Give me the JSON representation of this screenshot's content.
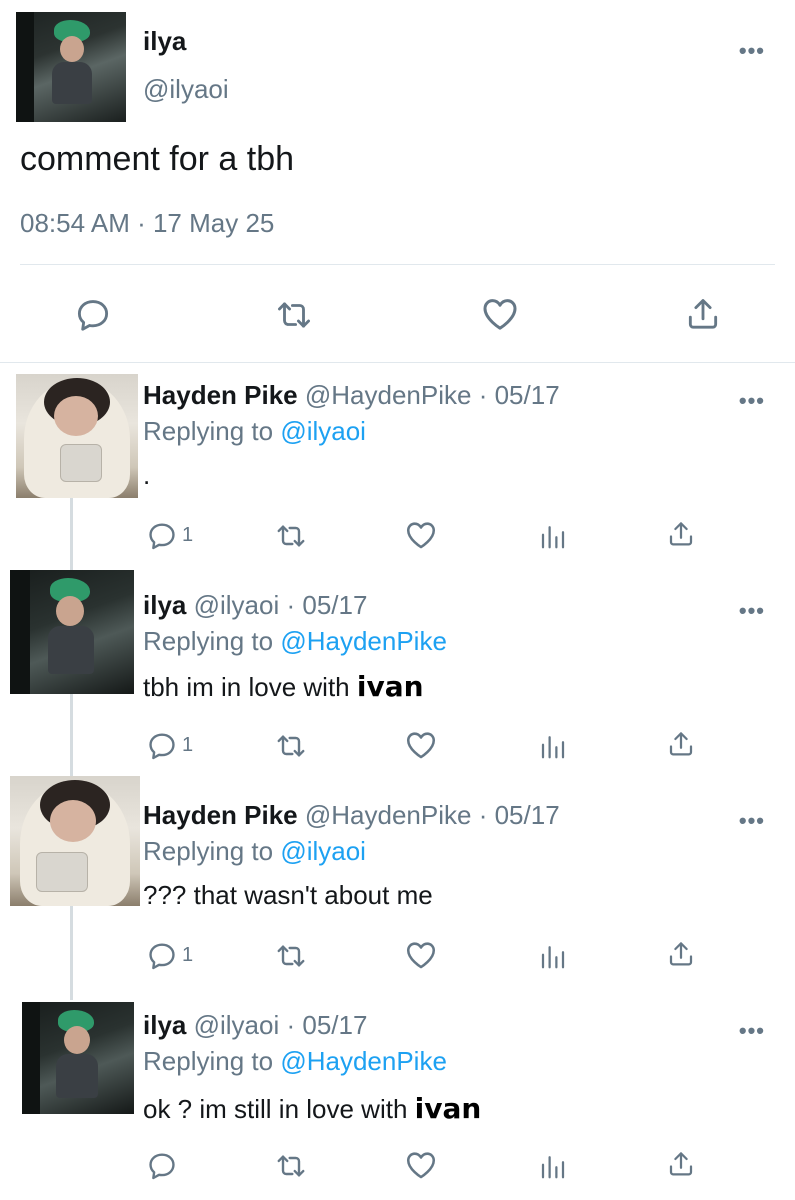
{
  "main_tweet": {
    "display_name": "ilya",
    "handle": "@ilyaoi",
    "text": "comment for a tbh",
    "timestamp": "08:54 AM · 17 May 25",
    "more_label": "•••"
  },
  "replies": [
    {
      "display_name": "Hayden Pike",
      "handle": "@HaydenPike",
      "date": "· 05/17",
      "replying_prefix": "Replying to",
      "replying_to": "@ilyaoi",
      "text": ".",
      "reply_count": "1",
      "more_label": "•••"
    },
    {
      "display_name": "ilya",
      "handle": "@ilyaoi",
      "date": "· 05/17",
      "replying_prefix": "Replying to",
      "replying_to": "@HaydenPike",
      "text": "tbh im in love with",
      "text_name": "ivan",
      "reply_count": "1",
      "more_label": "•••"
    },
    {
      "display_name": "Hayden Pike",
      "handle": "@HaydenPike",
      "date": "· 05/17",
      "replying_prefix": "Replying to",
      "replying_to": "@ilyaoi",
      "text": "??? that wasn't about me",
      "reply_count": "1",
      "more_label": "•••"
    },
    {
      "display_name": "ilya",
      "handle": "@ilyaoi",
      "date": "· 05/17",
      "replying_prefix": "Replying to",
      "replying_to": "@HaydenPike",
      "text": "ok ? im still in love with",
      "text_name": "ivan",
      "reply_count": "",
      "more_label": "•••"
    }
  ],
  "icons": [
    "comment-icon",
    "retweet-icon",
    "like-icon",
    "share-icon",
    "analytics-icon",
    "more-icon"
  ],
  "colors": {
    "link": "#1da1f2",
    "muted": "#657786",
    "text": "#14171a",
    "divider": "#e1e8ed"
  }
}
